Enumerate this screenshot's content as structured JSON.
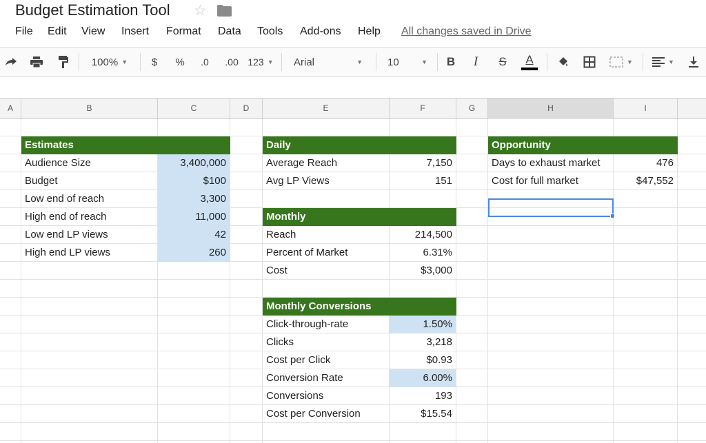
{
  "app": {
    "title": "Budget Estimation Tool",
    "saved_status": "All changes saved in Drive"
  },
  "menu": [
    "File",
    "Edit",
    "View",
    "Insert",
    "Format",
    "Data",
    "Tools",
    "Add-ons",
    "Help"
  ],
  "toolbar": {
    "zoom": "100%",
    "currency": "$",
    "percent": "%",
    "decrease_decimal": ".0",
    "increase_decimal": ".00",
    "more_formats": "123",
    "font": "Arial",
    "font_size": "10",
    "bold": "B",
    "italic": "I",
    "strikethrough": "S",
    "text_color": "A",
    "text_color_swatch": "#000000",
    "icons": [
      "redo-icon",
      "print-icon",
      "paint-format-icon",
      "fill-color-icon",
      "borders-icon",
      "merge-cells-icon",
      "align-left-icon",
      "valign-bottom-icon"
    ]
  },
  "columns": [
    "A",
    "B",
    "C",
    "D",
    "E",
    "F",
    "G",
    "H",
    "I"
  ],
  "selected_column": "H",
  "colors": {
    "header_green": "#38761d",
    "input_blue": "#cfe2f3",
    "selection_blue": "#4a86e8"
  },
  "estimates": {
    "header": "Estimates",
    "rows": [
      {
        "label": "Audience Size",
        "value": "3,400,000"
      },
      {
        "label": "Budget",
        "value": "$100"
      },
      {
        "label": "Low end of reach",
        "value": "3,300"
      },
      {
        "label": "High end of reach",
        "value": "11,000"
      },
      {
        "label": "Low end LP views",
        "value": "42"
      },
      {
        "label": "High end LP views",
        "value": "260"
      }
    ]
  },
  "daily": {
    "header": "Daily",
    "rows": [
      {
        "label": "Average Reach",
        "value": "7,150"
      },
      {
        "label": "Avg LP Views",
        "value": "151"
      }
    ]
  },
  "monthly": {
    "header": "Monthly",
    "rows": [
      {
        "label": "Reach",
        "value": "214,500"
      },
      {
        "label": "Percent of Market",
        "value": "6.31%"
      },
      {
        "label": "Cost",
        "value": "$3,000"
      }
    ]
  },
  "conversions": {
    "header": "Monthly Conversions",
    "rows": [
      {
        "label": "Click-through-rate",
        "value": "1.50%"
      },
      {
        "label": "Clicks",
        "value": "3,218"
      },
      {
        "label": "Cost per Click",
        "value": "$0.93"
      },
      {
        "label": "Conversion Rate",
        "value": "6.00%"
      },
      {
        "label": "Conversions",
        "value": "193"
      },
      {
        "label": "Cost per Conversion",
        "value": "$15.54"
      }
    ]
  },
  "opportunity": {
    "header": "Opportunity",
    "rows": [
      {
        "label": "Days to exhaust market",
        "value": "476"
      },
      {
        "label": "Cost for full market",
        "value": "$47,552"
      }
    ]
  }
}
